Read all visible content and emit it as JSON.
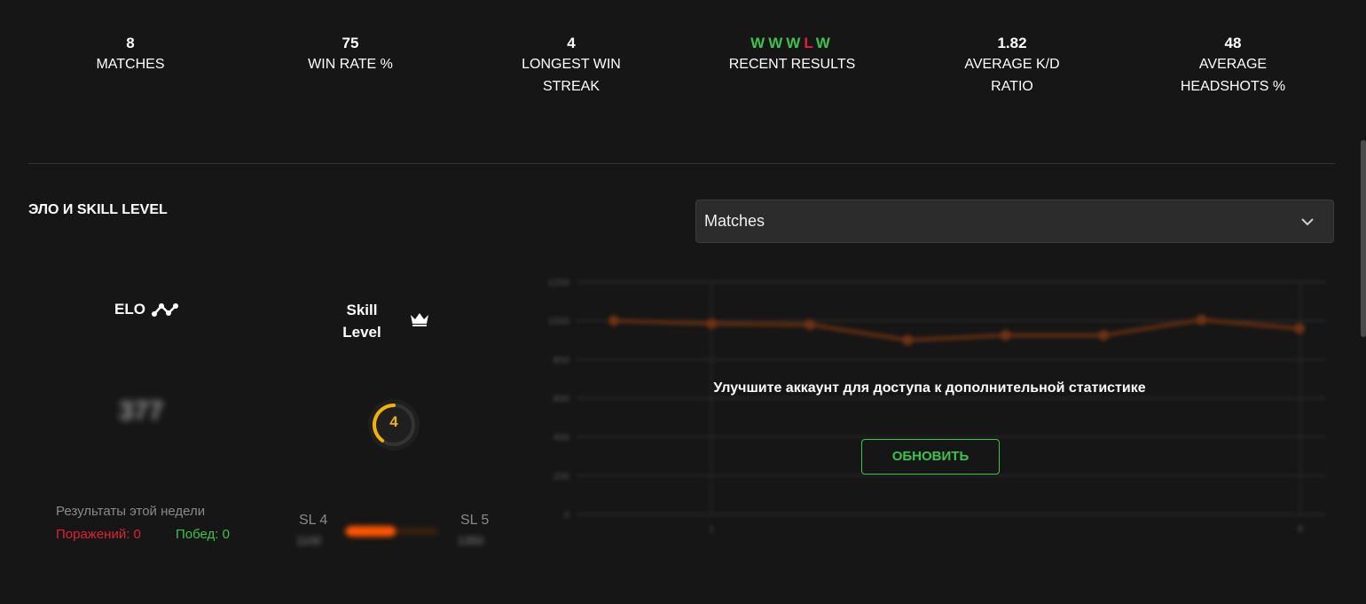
{
  "stats": [
    {
      "value": "8",
      "label": "MATCHES"
    },
    {
      "value": "75",
      "label": "WIN RATE %"
    },
    {
      "value": "4",
      "label": "LONGEST WIN STREAK"
    },
    {
      "value": "",
      "label": "RECENT RESULTS",
      "results": [
        "W",
        "W",
        "W",
        "L",
        "W"
      ]
    },
    {
      "value": "1.82",
      "label": "AVERAGE K/D RATIO"
    },
    {
      "value": "48",
      "label": "AVERAGE HEADSHOTS %"
    }
  ],
  "section": {
    "title": "ЭЛО И SKILL LEVEL"
  },
  "dropdown": {
    "selected": "Matches",
    "icon": "chevron-down-icon"
  },
  "elo": {
    "title": "ELO",
    "value": "377",
    "icon": "elo-graph-icon"
  },
  "skill": {
    "title": "Skill Level",
    "level": "4",
    "level_fraction": 0.4,
    "icon": "crown-icon"
  },
  "weekly": {
    "title": "Результаты этой недели",
    "losses": "Поражений: 0",
    "wins": "Побед: 0"
  },
  "progress": {
    "from_label": "SL 4",
    "to_label": "SL 5",
    "from_elo": "1100",
    "to_elo": "1350"
  },
  "upgrade": {
    "message": "Улучшите аккаунт для доступа к дополнительной статистике",
    "button": "ОБНОВИТЬ"
  },
  "colors": {
    "win": "#3cc34c",
    "loss": "#e02235",
    "accent": "#ff5500",
    "level": "#f2b400"
  },
  "chart_data": {
    "type": "line",
    "note_blurred": true,
    "y_ticks": [
      "1200",
      "1000",
      "800",
      "600",
      "400",
      "200",
      "0"
    ],
    "x_ticks": [
      "1",
      "8"
    ],
    "ylim": [
      0,
      1200
    ],
    "series": [
      {
        "values": [
          1000,
          985,
          980,
          900,
          925,
          925,
          1005,
          960
        ]
      }
    ]
  }
}
